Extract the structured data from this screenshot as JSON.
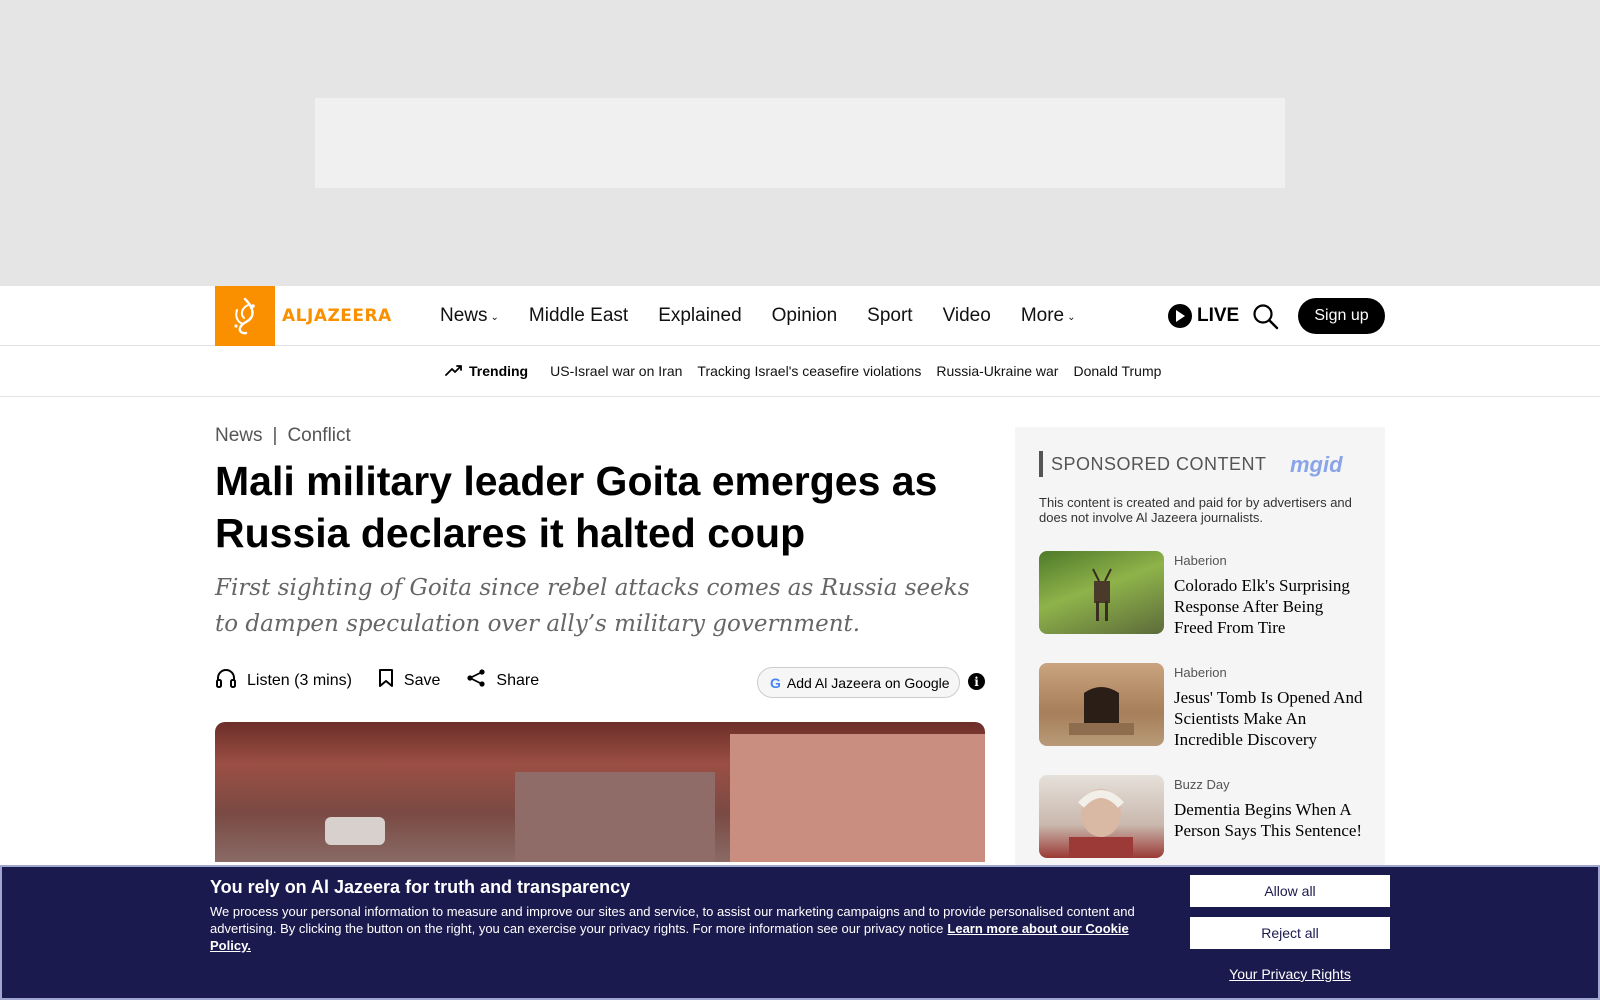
{
  "header": {
    "logo_text": "ALJAZEERA",
    "nav": [
      {
        "label": "News",
        "dropdown": true
      },
      {
        "label": "Middle East",
        "dropdown": false
      },
      {
        "label": "Explained",
        "dropdown": false
      },
      {
        "label": "Opinion",
        "dropdown": false
      },
      {
        "label": "Sport",
        "dropdown": false
      },
      {
        "label": "Video",
        "dropdown": false
      },
      {
        "label": "More",
        "dropdown": true
      }
    ],
    "live_label": "LIVE",
    "signup_label": "Sign up",
    "brand_color": "#fa9000"
  },
  "trending": {
    "label": "Trending",
    "links": [
      "US-Israel war on Iran",
      "Tracking Israel's ceasefire violations",
      "Russia-Ukraine war",
      "Donald Trump"
    ]
  },
  "article": {
    "breadcrumb_section": "News",
    "breadcrumb_separator": "|",
    "breadcrumb_topic": "Conflict",
    "headline": "Mali military leader Goita emerges as Russia declares it halted coup",
    "standfirst": "First sighting of Goita since rebel attacks comes as Russia seeks to dampen speculation over ally’s military government.",
    "listen_label": "Listen (3 mins)",
    "save_label": "Save",
    "share_label": "Share",
    "google_label": "Add Al Jazeera on Google",
    "info_glyph": "i"
  },
  "sidebar": {
    "title": "SPONSORED CONTENT",
    "provider": "mgid",
    "note": "This content is created and paid for by advertisers and does not involve Al Jazeera journalists.",
    "items": [
      {
        "source": "Haberion",
        "title": "Colorado Elk's Surprising Response After Being Freed From Tire"
      },
      {
        "source": "Haberion",
        "title": "Jesus' Tomb Is Opened And Scientists Make An Incredible Discovery"
      },
      {
        "source": "Buzz Day",
        "title": "Dementia Begins When A Person Says This Sentence!"
      }
    ]
  },
  "cookie": {
    "title": "You rely on Al Jazeera for truth and transparency",
    "body": "We process your personal information to measure and improve our sites and service, to assist our marketing campaigns and to provide personalised content and advertising. By clicking the button on the right, you can exercise your privacy rights. For more information see our privacy notice",
    "policy_link": "Learn more about our Cookie Policy.",
    "allow_label": "Allow all",
    "reject_label": "Reject all",
    "privacy_link": "Your Privacy Rights",
    "bg_color": "#1b1a4e"
  }
}
